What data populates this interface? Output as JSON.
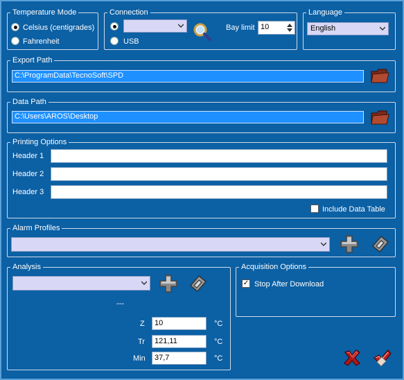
{
  "temperature_mode": {
    "legend": "Temperature Mode",
    "options": [
      {
        "label": "Celsius (centigrades)",
        "checked": true
      },
      {
        "label": "Fahrenheit",
        "checked": false
      }
    ]
  },
  "connection": {
    "legend": "Connection",
    "port_value": "",
    "usb_label": "USB",
    "bay_limit_label": "Bay limit",
    "bay_limit_value": "10"
  },
  "language": {
    "legend": "Language",
    "selected": "English"
  },
  "export_path": {
    "legend": "Export Path",
    "value": "C:\\ProgramData\\TecnoSoft\\SPD"
  },
  "data_path": {
    "legend": "Data Path",
    "value": "C:\\Users\\AROS\\Desktop"
  },
  "printing_options": {
    "legend": "Printing Options",
    "headers": [
      {
        "label": "Header 1",
        "value": ""
      },
      {
        "label": "Header 2",
        "value": ""
      },
      {
        "label": "Header 3",
        "value": ""
      }
    ],
    "include_data_table_label": "Include Data Table",
    "include_data_table_checked": false
  },
  "alarm_profiles": {
    "legend": "Alarm Profiles",
    "selected": ""
  },
  "analysis": {
    "legend": "Analysis",
    "selected": "",
    "placeholder_text": "---",
    "fields": [
      {
        "label": "Z",
        "value": "10",
        "unit": "°C"
      },
      {
        "label": "Tr",
        "value": "121,11",
        "unit": "°C"
      },
      {
        "label": "Min",
        "value": "37,7",
        "unit": "°C"
      }
    ]
  },
  "acquisition_options": {
    "legend": "Acquisition Options",
    "stop_after_download_label": "Stop After Download",
    "stop_after_download_checked": true
  },
  "icons": {
    "search": "magnifier-icon",
    "folder": "folder-icon",
    "add": "add-icon",
    "edit": "edit-icon",
    "cancel": "cancel-icon",
    "confirm": "confirm-icon"
  },
  "colors": {
    "background": "#0c60a4",
    "path_field": "#1e90ff",
    "combo": "#d8d8f6"
  }
}
